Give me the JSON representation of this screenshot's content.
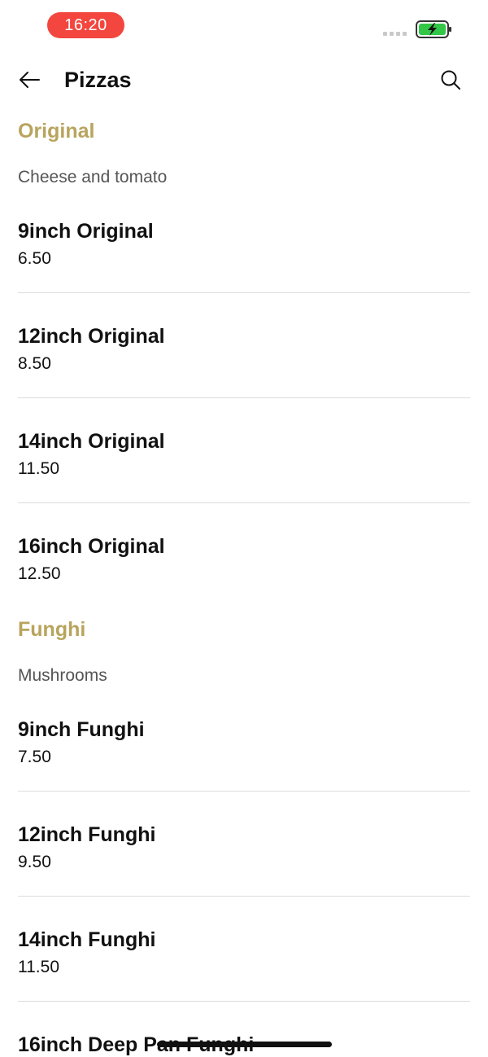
{
  "status_bar": {
    "time": "16:20",
    "icons": [
      "signal-icon",
      "battery-charging-icon"
    ],
    "time_pill_color": "#f2463f",
    "battery_color": "#33c748"
  },
  "header": {
    "back_icon": "arrow-left-icon",
    "title": "Pizzas",
    "search_icon": "search-icon"
  },
  "accent_color": "#b8a45d",
  "sections": [
    {
      "title": "Original",
      "description": "Cheese and tomato",
      "items": [
        {
          "name": "9inch Original",
          "price": "6.50"
        },
        {
          "name": "12inch Original",
          "price": "8.50"
        },
        {
          "name": "14inch Original",
          "price": "11.50"
        },
        {
          "name": "16inch Original",
          "price": "12.50"
        }
      ]
    },
    {
      "title": "Funghi",
      "description": "Mushrooms",
      "items": [
        {
          "name": "9inch Funghi",
          "price": "7.50"
        },
        {
          "name": "12inch Funghi",
          "price": "9.50"
        },
        {
          "name": "14inch Funghi",
          "price": "11.50"
        },
        {
          "name": "16inch Deep Pan Funghi",
          "price": ""
        }
      ]
    }
  ]
}
